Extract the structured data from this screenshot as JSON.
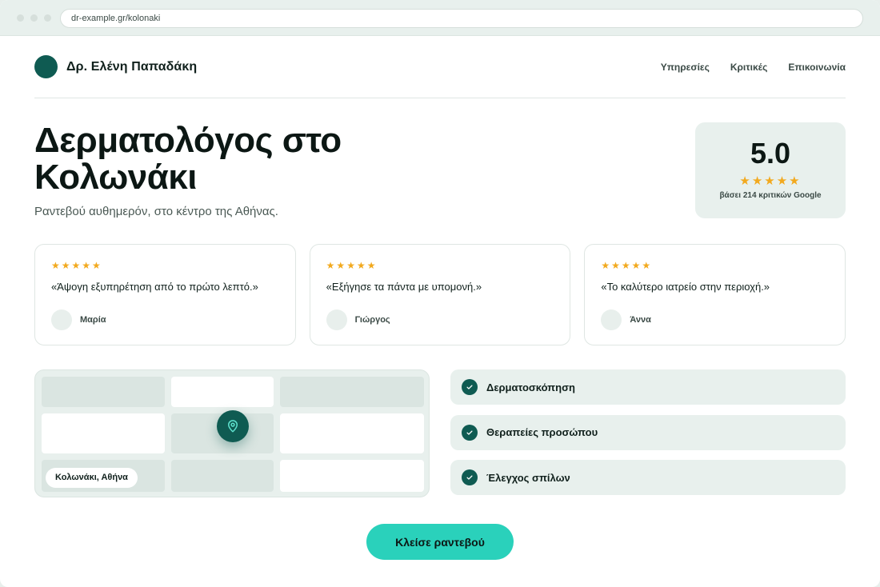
{
  "browser": {
    "url": "dr-example.gr/kolonaki"
  },
  "header": {
    "brand": "Δρ. Ελένη Παπαδάκη",
    "nav": [
      "Υπηρεσίες",
      "Κριτικές",
      "Επικοινωνία"
    ]
  },
  "hero": {
    "title": "Δερματολόγος στο Κολωνάκι",
    "subtitle": "Ραντεβού αυθημερόν, στο κέντρο της Αθήνας."
  },
  "rating": {
    "score": "5.0",
    "stars": "★★★★★",
    "note": "βάσει 214 κριτικών Google"
  },
  "reviews": [
    {
      "stars": "★★★★★",
      "quote": "«Άψογη εξυπηρέτηση από το πρώτο λεπτό.»",
      "name": "Μαρία"
    },
    {
      "stars": "★★★★★",
      "quote": "«Εξήγησε τα πάντα με υπομονή.»",
      "name": "Γιώργος"
    },
    {
      "stars": "★★★★★",
      "quote": "«Το καλύτερο ιατρείο στην περιοχή.»",
      "name": "Άννα"
    }
  ],
  "map": {
    "label": "Κολωνάκι, Αθήνα",
    "pin_icon": "map-pin-icon"
  },
  "services": [
    "Δερματοσκόπηση",
    "Θεραπείες προσώπου",
    "Έλεγχος σπίλων"
  ],
  "cta": {
    "label": "Κλείσε ραντεβού"
  },
  "colors": {
    "brand": "#0f5b52",
    "accent": "#2ad1bb",
    "star": "#f2a91e",
    "panel": "#e8f0ed"
  }
}
